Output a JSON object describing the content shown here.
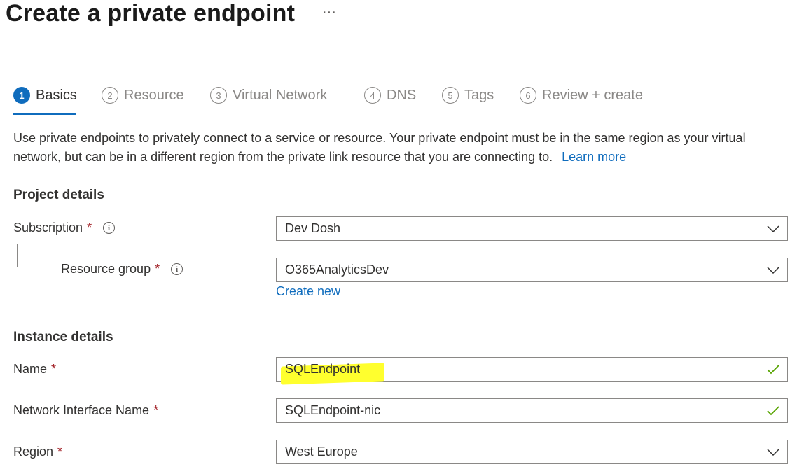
{
  "page": {
    "title": "Create a private endpoint",
    "more_label": "···"
  },
  "tabs": [
    {
      "num": "1",
      "label": "Basics",
      "active": true
    },
    {
      "num": "2",
      "label": "Resource"
    },
    {
      "num": "3",
      "label": "Virtual Network"
    },
    {
      "num": "4",
      "label": "DNS"
    },
    {
      "num": "5",
      "label": "Tags"
    },
    {
      "num": "6",
      "label": "Review + create"
    }
  ],
  "description": {
    "text": "Use private endpoints to privately connect to a service or resource. Your private endpoint must be in the same region as your virtual network, but can be in a different region from the private link resource that you are connecting to.",
    "learn_more": "Learn more"
  },
  "project": {
    "heading": "Project details",
    "subscription": {
      "label": "Subscription",
      "required": "*",
      "value": "Dev Dosh"
    },
    "resource_group": {
      "label": "Resource group",
      "required": "*",
      "value": "O365AnalyticsDev",
      "create_new": "Create new"
    }
  },
  "instance": {
    "heading": "Instance details",
    "name": {
      "label": "Name",
      "required": "*",
      "value": "SQLEndpoint"
    },
    "nic": {
      "label": "Network Interface Name",
      "required": "*",
      "value": "SQLEndpoint-nic"
    },
    "region": {
      "label": "Region",
      "required": "*",
      "value": "West Europe"
    }
  },
  "colors": {
    "accent": "#0f6cbd",
    "required": "#a4262c",
    "valid": "#57a300",
    "highlight": "#ffff2e"
  },
  "icons": {
    "info": "info-icon",
    "chevron": "chevron-down-icon",
    "check": "check-icon"
  }
}
